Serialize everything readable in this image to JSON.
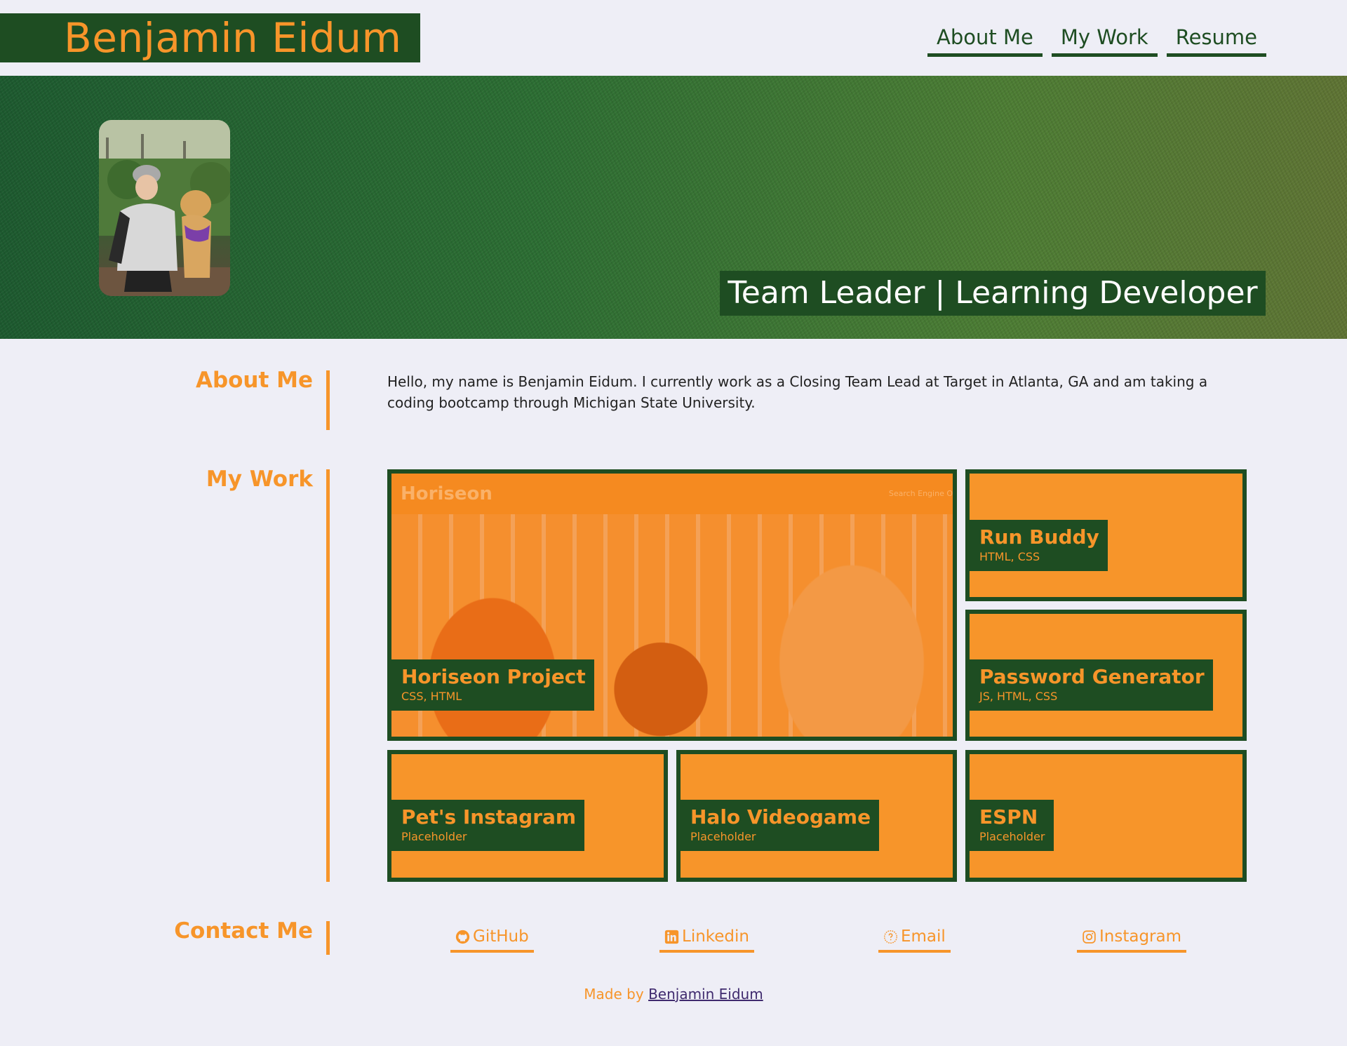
{
  "header": {
    "site_title": "Benjamin Eidum",
    "nav": [
      "About Me",
      "My Work",
      "Resume"
    ]
  },
  "hero": {
    "tagline": "Team Leader | Learning Developer"
  },
  "about": {
    "heading": "About Me",
    "text": "Hello, my name is Benjamin Eidum. I currently work as a Closing Team Lead at Target in Atlanta, GA and am taking a coding bootcamp through Michigan State University."
  },
  "work": {
    "heading": "My Work",
    "featured_shot": {
      "logo": "Horiseon",
      "search": "Search Engine O"
    },
    "projects": [
      {
        "name": "Horiseon Project",
        "tech": "CSS, HTML"
      },
      {
        "name": "Run Buddy",
        "tech": "HTML, CSS"
      },
      {
        "name": "Password Generator",
        "tech": "JS, HTML, CSS"
      },
      {
        "name": "Pet's Instagram",
        "tech": "Placeholder"
      },
      {
        "name": "Halo Videogame",
        "tech": "Placeholder"
      },
      {
        "name": "ESPN",
        "tech": "Placeholder"
      }
    ]
  },
  "contact": {
    "heading": "Contact Me",
    "links": [
      {
        "label": "GitHub",
        "icon": "github-icon"
      },
      {
        "label": "Linkedin",
        "icon": "linkedin-icon"
      },
      {
        "label": "Email",
        "icon": "email-icon"
      },
      {
        "label": "Instagram",
        "icon": "instagram-icon"
      }
    ]
  },
  "footer": {
    "prefix": "Made by",
    "author_link": "Benjamin Eidum"
  },
  "colors": {
    "accent_orange": "#f7952a",
    "brand_green": "#1e4d22",
    "page_background": "#eeeef6"
  }
}
